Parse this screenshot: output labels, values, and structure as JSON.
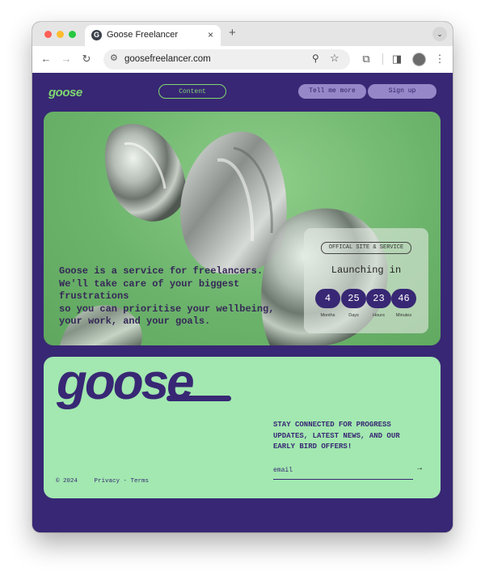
{
  "browser": {
    "tab_title": "Goose Freelancer",
    "url": "goosefreelancer.com",
    "new_tab": "+",
    "close": "×"
  },
  "nav": {
    "logo": "goose",
    "content": "Content",
    "tell_me_more": "Tell me more",
    "sign_up": "Sign up"
  },
  "hero": {
    "lines": [
      "Goose is a service for freelancers.",
      "We'll take care of your biggest",
      "frustrations",
      "so you can prioritise your wellbeing,",
      "your work, and your goals."
    ]
  },
  "launch": {
    "badge": "OFFICAL SITE & SERVICE",
    "title": "Launching in",
    "countdown": [
      {
        "value": "4",
        "label": "Months"
      },
      {
        "value": "25",
        "label": "Days"
      },
      {
        "value": "23",
        "label": "Hours"
      },
      {
        "value": "46",
        "label": "Minutes"
      }
    ]
  },
  "footer": {
    "logo": "goose",
    "newsletter_lines": [
      "STAY CONNECTED FOR PROGRESS",
      "UPDATES, LATEST NEWS, AND OUR",
      "EARLY BIRD OFFERS!"
    ],
    "email_placeholder": "email",
    "submit": "→",
    "copyright": "© 2024",
    "privacy_terms": "Privacy - Terms"
  },
  "colors": {
    "page_bg": "#382774",
    "accent_green": "#7fd870",
    "hero_green": "#6cb46c",
    "footer_card": "#a2e8b0",
    "nav_pill": "#9688c8"
  },
  "icons": [
    "back-icon",
    "forward-icon",
    "reload-icon",
    "site-info-icon",
    "zoom-icon",
    "bookmark-star-icon",
    "extensions-icon",
    "sidepanel-icon",
    "profile-avatar",
    "menu-icon",
    "arrow-right-icon"
  ]
}
